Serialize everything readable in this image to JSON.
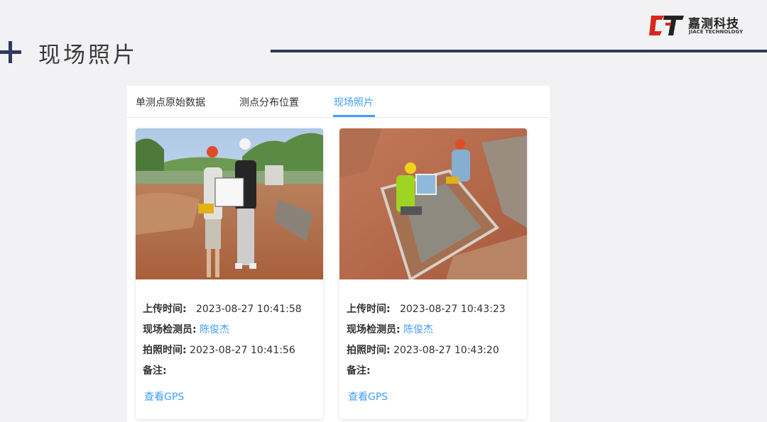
{
  "slide": {
    "title": "现场照片",
    "brand": {
      "name_cn": "嘉测科技",
      "name_en": "JIACE TECHNOLOGY"
    }
  },
  "colors": {
    "accent": "#409eff",
    "header_rule": "#2e3a5c",
    "brand_red": "#d9281e"
  },
  "tabs": [
    {
      "label": "单测点原始数据",
      "active": false
    },
    {
      "label": "测点分布位置",
      "active": false
    },
    {
      "label": "现场照片",
      "active": true
    }
  ],
  "photos": [
    {
      "upload_label": "上传时间:",
      "upload_time": "2023-08-27 10:41:58",
      "inspector_label": "现场检测员:",
      "inspector": "陈俊杰",
      "shot_label": "拍照时间:",
      "shot_time": "2023-08-27 10:41:56",
      "note_label": "备注:",
      "note": "",
      "gps_link": "查看GPS"
    },
    {
      "upload_label": "上传时间:",
      "upload_time": "2023-08-27 10:43:23",
      "inspector_label": "现场检测员:",
      "inspector": "陈俊杰",
      "shot_label": "拍照时间:",
      "shot_time": "2023-08-27 10:43:20",
      "note_label": "备注:",
      "note": "",
      "gps_link": "查看GPS"
    }
  ]
}
